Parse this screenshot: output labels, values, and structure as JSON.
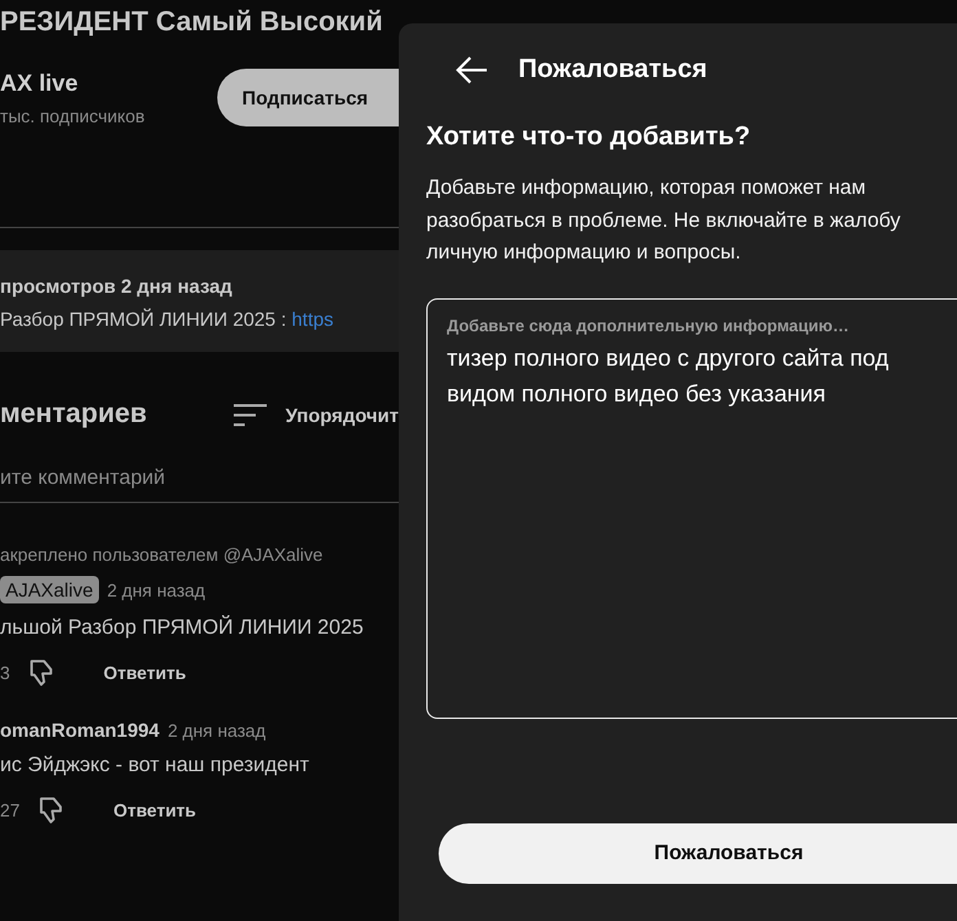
{
  "video": {
    "title": "РЕЗИДЕНТ Самый Высокий",
    "channel": "AX live",
    "subscribers": "тыс. подписчиков",
    "subscribe_button": "Подписаться",
    "stats": "просмотров  2 дня назад",
    "description": "Разбор ПРЯМОЙ ЛИНИИ 2025 : ",
    "description_link": "https"
  },
  "comments": {
    "heading": "ментариев",
    "sort": "Упорядочит",
    "placeholder": "ите комментарий",
    "items": [
      {
        "pinned": "акреплено пользователем @AJAXalive",
        "author": "AJAXalive",
        "author_is_owner": true,
        "time": "2 дня назад",
        "text": "льшой Разбор ПРЯМОЙ ЛИНИИ 2025",
        "likes": "3",
        "reply": "Ответить"
      },
      {
        "author": "omanRoman1994",
        "author_is_owner": false,
        "time": "2 дня назад",
        "text": "ис Эйджэкс - вот наш президент",
        "likes": "27",
        "reply": "Ответить"
      }
    ]
  },
  "report": {
    "title": "Пожаловаться",
    "heading": "Хотите что-то добавить?",
    "description": "Добавьте информацию, которая поможет нам разобраться в проблеме. Не включайте в жалобу личную информацию и вопросы.",
    "field": {
      "label": "Добавьте сюда дополнительную информацию…",
      "value": "тизер полного видео с другого сайта под видом полного видео без указания"
    },
    "submit": "Пожаловаться"
  }
}
